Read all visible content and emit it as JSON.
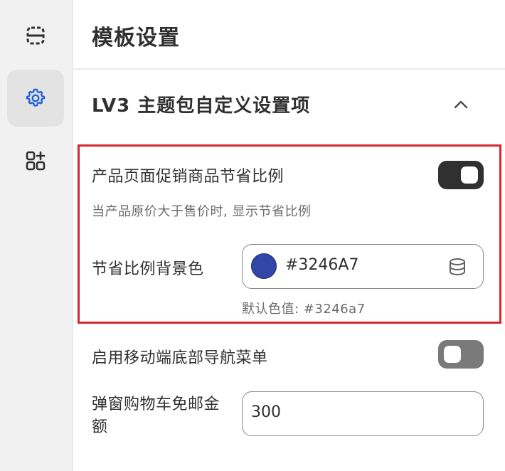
{
  "rail": {
    "items": [
      {
        "icon": "layout-sections-icon"
      },
      {
        "icon": "gear-icon",
        "active": true
      },
      {
        "icon": "apps-add-icon"
      }
    ]
  },
  "page": {
    "title": "模板设置"
  },
  "section": {
    "title": "LV3 主题包自定义设置项",
    "icon": "chevron-up-icon"
  },
  "settings": {
    "savings_ratio": {
      "label": "产品页面促销商品节省比例",
      "enabled": true,
      "help": "当产品原价大于售价时, 显示节省比例"
    },
    "savings_bg_color": {
      "label": "节省比例背景色",
      "value": "#3246A7",
      "swatch_color": "#3246A7",
      "default_text": "默认色值: #3246a7"
    },
    "mobile_bottom_nav": {
      "label": "启用移动端底部导航菜单",
      "enabled": false
    },
    "free_shipping": {
      "label_line1": "弹窗购物车免邮金",
      "label_line2": "额",
      "value": "300"
    }
  },
  "colors": {
    "highlight_border": "#d6282e",
    "toggle_on": "#303030",
    "toggle_off": "#7a7a7a",
    "active_icon": "#2463d6"
  }
}
